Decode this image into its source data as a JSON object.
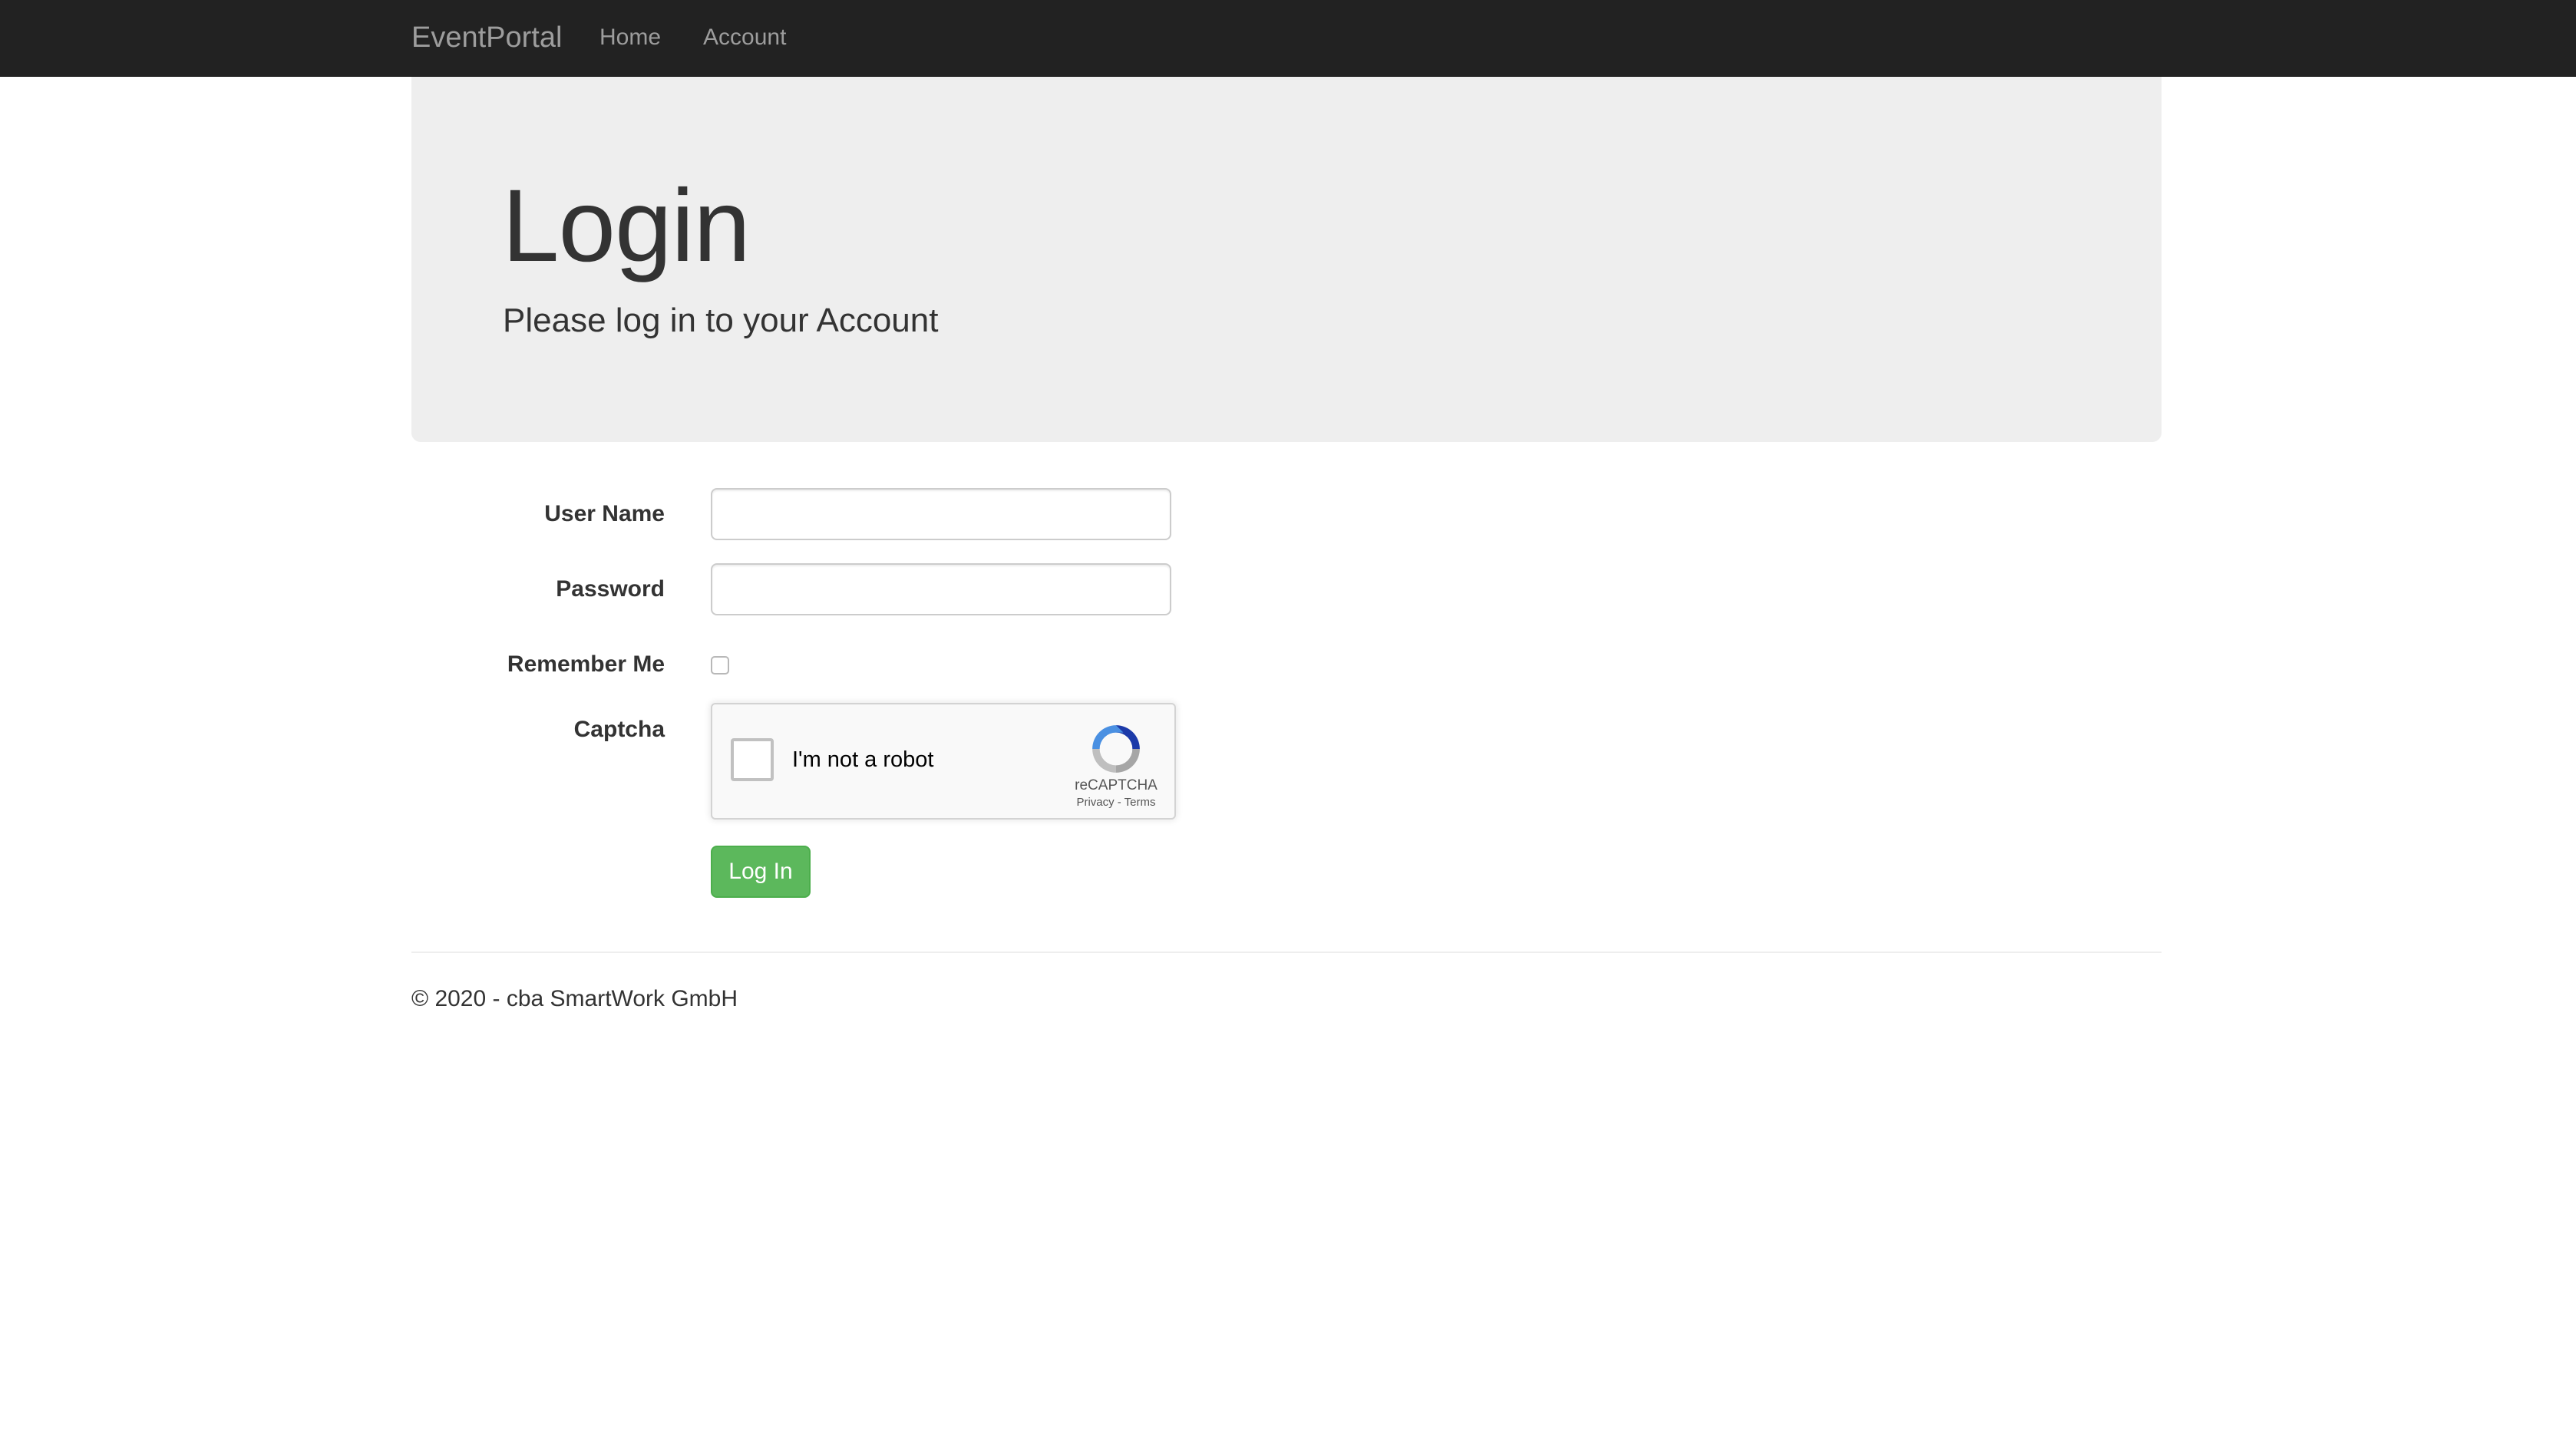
{
  "navbar": {
    "brand": "EventPortal",
    "links": [
      {
        "label": "Home"
      },
      {
        "label": "Account"
      }
    ]
  },
  "jumbotron": {
    "title": "Login",
    "lead": "Please log in to your Account"
  },
  "form": {
    "username_label": "User Name",
    "username_value": "",
    "password_label": "Password",
    "password_value": "",
    "remember_label": "Remember Me",
    "remember_checked": false,
    "captcha_label": "Captcha",
    "submit_label": "Log In"
  },
  "recaptcha": {
    "prompt": "I'm not a robot",
    "brand": "reCAPTCHA",
    "links": "Privacy - Terms"
  },
  "footer": {
    "text": "© 2020 - cba SmartWork GmbH"
  },
  "colors": {
    "navbar_bg": "#222222",
    "nav_text": "#9d9d9d",
    "jumbotron_bg": "#eeeeee",
    "success": "#5cb85c",
    "recaptcha_blue": "#4a90e2"
  }
}
